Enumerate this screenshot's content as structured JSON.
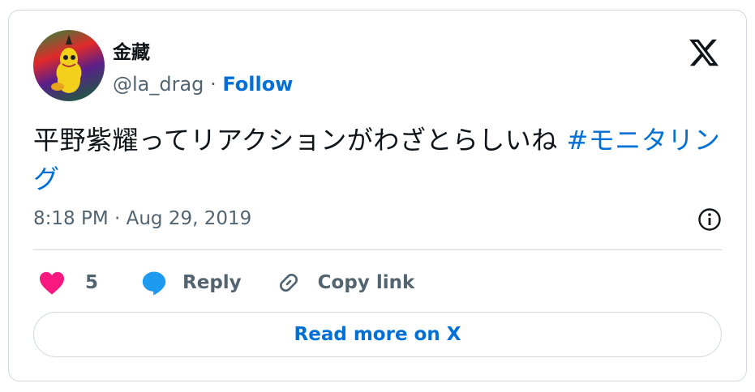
{
  "author": {
    "display_name": "金藏",
    "handle": "@la_drag",
    "separator": "·",
    "follow_label": "Follow"
  },
  "tweet": {
    "text": "平野紫耀ってリアクションがわざとらしいね ",
    "hashtag": "#モニタリング",
    "timestamp": "8:18 PM · Aug 29, 2019"
  },
  "actions": {
    "like_count": "5",
    "reply_label": "Reply",
    "copy_label": "Copy link"
  },
  "read_more_label": "Read more on X",
  "colors": {
    "link": "#006fd6",
    "like": "#f91880",
    "reply": "#1d9bf0",
    "muted": "#536471",
    "border": "#cfd9de"
  }
}
